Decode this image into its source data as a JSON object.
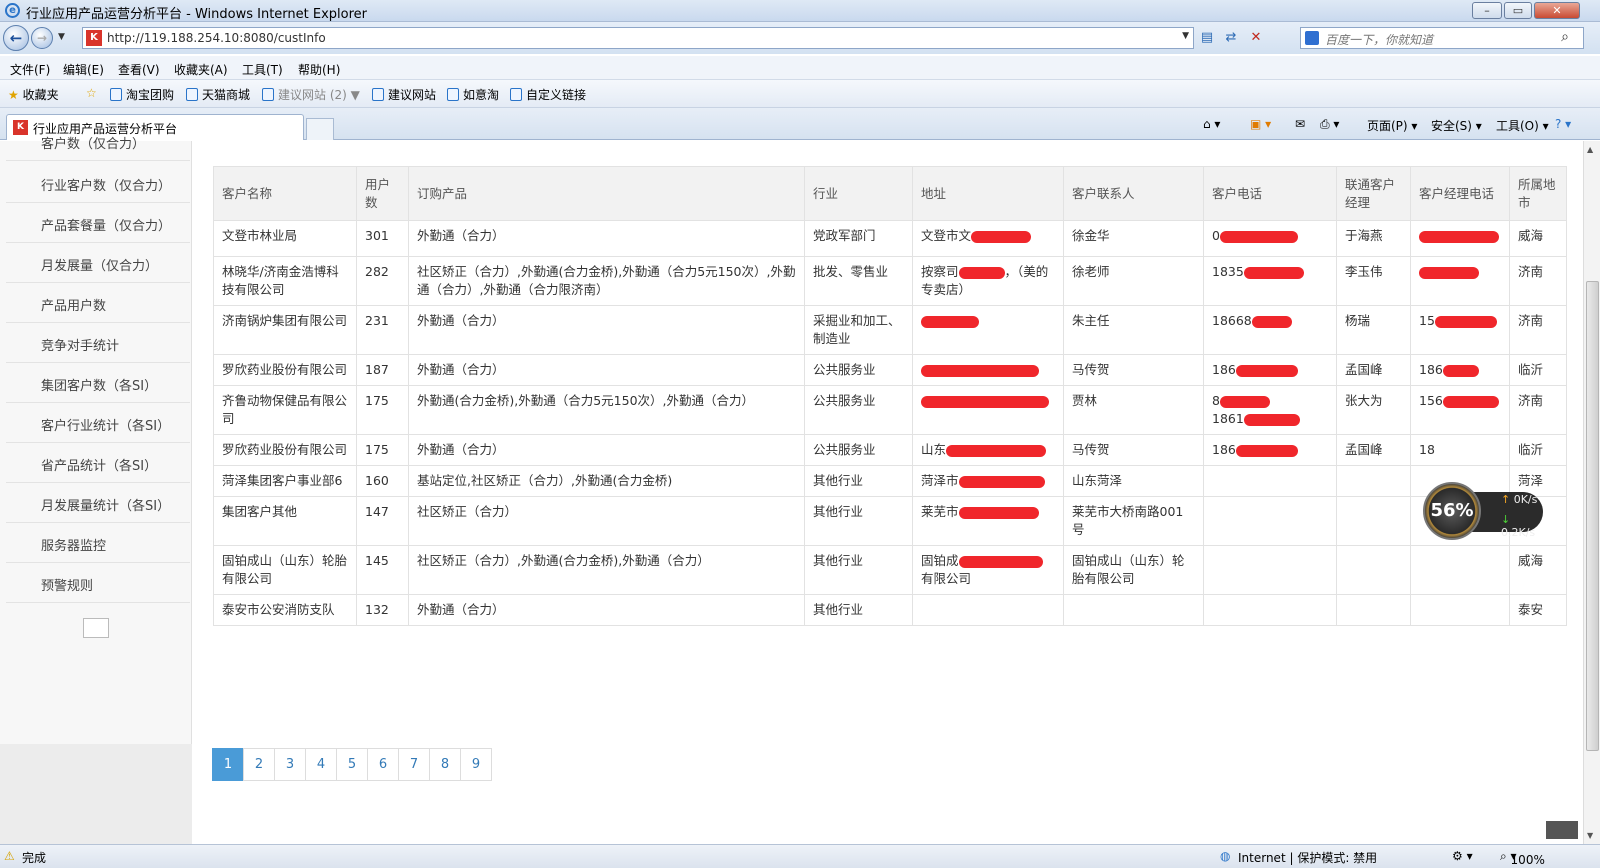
{
  "window": {
    "title": "行业应用产品运营分析平台 - Windows Internet Explorer",
    "address": "http://119.188.254.10:8080/custInfo",
    "search_placeholder": "百度一下，你就知道"
  },
  "menu": [
    "文件(F)",
    "编辑(E)",
    "查看(V)",
    "收藏夹(A)",
    "工具(T)",
    "帮助(H)"
  ],
  "favorites": {
    "label": "收藏夹",
    "items": [
      "淘宝团购",
      "天猫商城",
      "建议网站 (2)",
      "建议网站",
      "如意淘",
      "自定义链接"
    ]
  },
  "tab": {
    "title": "行业应用产品运营分析平台"
  },
  "commands": {
    "page": "页面(P)",
    "safety": "安全(S)",
    "tools": "工具(O)"
  },
  "sidebar": {
    "items": [
      "客户数（仅合力）",
      "行业客户数（仅合力）",
      "产品套餐量（仅合力）",
      "月发展量（仅合力）",
      "产品用户数",
      "竞争对手统计",
      "集团客户数（各SI）",
      "客户行业统计（各SI）",
      "省产品统计（各SI）",
      "月发展量统计（各SI）",
      "服务器监控",
      "预警规则"
    ]
  },
  "table": {
    "headers": [
      "客户名称",
      "用户数",
      "订购产品",
      "行业",
      "地址",
      "客户联系人",
      "客户电话",
      "联通客户经理",
      "客户经理电话",
      "所属地市"
    ],
    "rows": [
      {
        "name": "文登市林业局",
        "users": "301",
        "product": "外勤通（合力）",
        "industry": "党政军部门",
        "address": "文登市文",
        "contact": "徐金华",
        "phone": "0",
        "manager": "于海燕",
        "manager_phone": "",
        "city": "威海"
      },
      {
        "name": "林晓华/济南金浩博科技有限公司",
        "users": "282",
        "product": "社区矫正（合力）,外勤通(合力金桥),外勤通（合力5元150次）,外勤通（合力）,外勤通（合力限济南）",
        "industry": "批发、零售业",
        "address": "按察司",
        "address_tail": "，（美的专卖店）",
        "contact": "徐老师",
        "phone": "1835",
        "manager": "李玉伟",
        "manager_phone": "",
        "city": "济南"
      },
      {
        "name": "济南锅炉集团有限公司",
        "users": "231",
        "product": "外勤通（合力）",
        "industry": "采掘业和加工、制造业",
        "address": "",
        "contact": "朱主任",
        "phone": "18668",
        "manager": "杨瑞",
        "manager_phone": "15",
        "city": "济南"
      },
      {
        "name": "罗欣药业股份有限公司",
        "users": "187",
        "product": "外勤通（合力）",
        "industry": "公共服务业",
        "address": "",
        "contact": "马传贺",
        "phone": "186",
        "manager": "孟国峰",
        "manager_phone": "186",
        "city": "临沂"
      },
      {
        "name": "齐鲁动物保健品有限公司",
        "users": "175",
        "product": "外勤通(合力金桥),外勤通（合力5元150次）,外勤通（合力）",
        "industry": "公共服务业",
        "address": "",
        "contact": "贾林",
        "phone": "8",
        "phone2": "1861",
        "manager": "张大为",
        "manager_phone": "156",
        "city": "济南"
      },
      {
        "name": "罗欣药业股份有限公司",
        "users": "175",
        "product": "外勤通（合力）",
        "industry": "公共服务业",
        "address": "山东",
        "contact": "马传贺",
        "phone": "186",
        "manager": "孟国峰",
        "manager_phone": "18",
        "city": "临沂"
      },
      {
        "name": "菏泽集团客户事业部6",
        "users": "160",
        "product": "基站定位,社区矫正（合力）,外勤通(合力金桥)",
        "industry": "其他行业",
        "address": "菏泽市",
        "contact": "山东菏泽",
        "phone": "",
        "manager": "",
        "manager_phone": "",
        "city": "菏泽"
      },
      {
        "name": "集团客户其他",
        "users": "147",
        "product": "社区矫正（合力）",
        "industry": "其他行业",
        "address": "莱芜市",
        "contact": "莱芜市大桥南路001号",
        "phone": "",
        "manager": "",
        "manager_phone": "",
        "city": "莱芜"
      },
      {
        "name": "固铂成山（山东）轮胎有限公司",
        "users": "145",
        "product": "社区矫正（合力）,外勤通(合力金桥),外勤通（合力）",
        "industry": "其他行业",
        "address": "固铂成",
        "address_tail": "有限公司",
        "contact": "固铂成山（山东）轮胎有限公司",
        "phone": "",
        "manager": "",
        "manager_phone": "",
        "city": "威海"
      },
      {
        "name": "泰安市公安消防支队",
        "users": "132",
        "product": "外勤通（合力）",
        "industry": "其他行业",
        "address": "",
        "contact": "",
        "phone": "",
        "manager": "",
        "manager_phone": "",
        "city": "泰安"
      }
    ]
  },
  "pagination": [
    "1",
    "2",
    "3",
    "4",
    "5",
    "6",
    "7",
    "8",
    "9"
  ],
  "speed_widget": {
    "percent": "56%",
    "up": "0K/s",
    "down": "0.2K/s"
  },
  "status": {
    "left": "完成",
    "zone": "Internet | 保护模式: 禁用",
    "zoom": "100%"
  },
  "colors": {
    "redaction": "#f0262b",
    "pager_active": "#4a9bd7"
  }
}
